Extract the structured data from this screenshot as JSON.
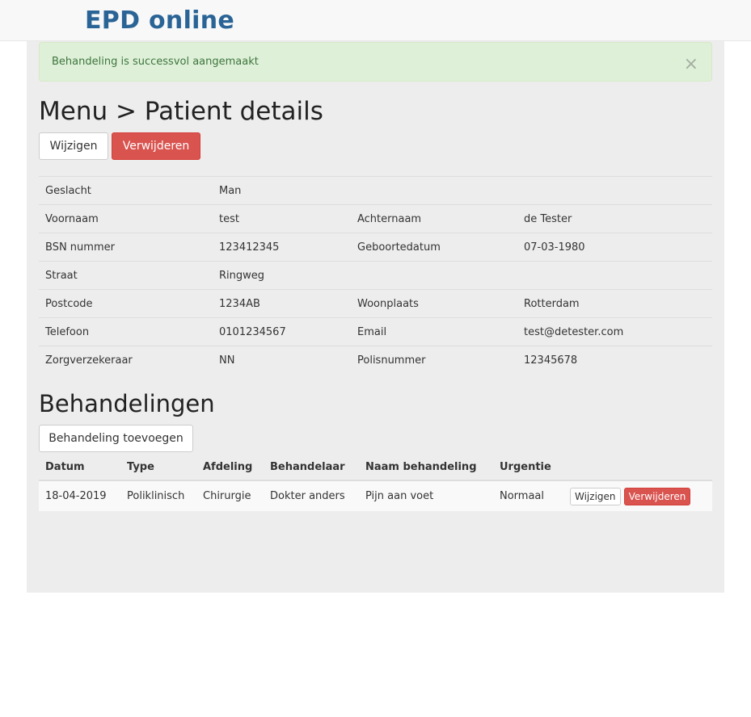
{
  "navbar": {
    "brand": "EPD online"
  },
  "alert": {
    "message": "Behandeling is successvol aangemaakt",
    "close_symbol": "×"
  },
  "page": {
    "title": "Menu > Patient details"
  },
  "patient_actions": {
    "edit_label": "Wijzigen",
    "delete_label": "Verwijderen"
  },
  "patient": {
    "rows": [
      {
        "label1": "Geslacht",
        "value1": "Man",
        "label2": "",
        "value2": ""
      },
      {
        "label1": "Voornaam",
        "value1": "test",
        "label2": "Achternaam",
        "value2": "de Tester"
      },
      {
        "label1": "BSN nummer",
        "value1": "123412345",
        "label2": "Geboortedatum",
        "value2": "07-03-1980"
      },
      {
        "label1": "Straat",
        "value1": "Ringweg",
        "label2": "",
        "value2": ""
      },
      {
        "label1": "Postcode",
        "value1": "1234AB",
        "label2": "Woonplaats",
        "value2": "Rotterdam"
      },
      {
        "label1": "Telefoon",
        "value1": "0101234567",
        "label2": "Email",
        "value2": "test@detester.com"
      },
      {
        "label1": "Zorgverzekeraar",
        "value1": "NN",
        "label2": "Polisnummer",
        "value2": "12345678"
      }
    ]
  },
  "treatments": {
    "title": "Behandelingen",
    "add_label": "Behandeling toevoegen",
    "columns": [
      "Datum",
      "Type",
      "Afdeling",
      "Behandelaar",
      "Naam behandeling",
      "Urgentie"
    ],
    "rows": [
      {
        "datum": "18-04-2019",
        "type": "Poliklinisch",
        "afdeling": "Chirurgie",
        "behandelaar": "Dokter anders",
        "naam": "Pijn aan voet",
        "urgentie": "Normaal",
        "edit_label": "Wijzigen",
        "delete_label": "Verwijderen"
      }
    ]
  },
  "colors": {
    "brand": "#2a6496",
    "danger": "#d9534f",
    "success_bg": "#dff0d8",
    "success_text": "#3c763d"
  }
}
